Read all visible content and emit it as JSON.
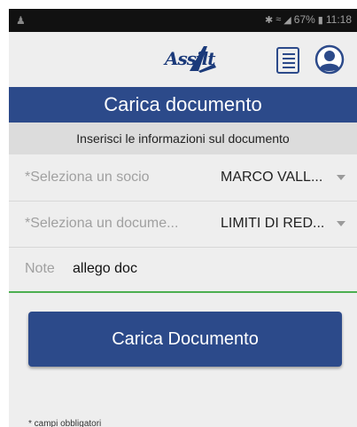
{
  "status_bar": {
    "battery": "67%",
    "time": "11:18",
    "icons": [
      "app-notification-icon",
      "bluetooth-icon",
      "wifi-icon",
      "signal-icon",
      "battery-icon"
    ]
  },
  "app_bar": {
    "logo_text": "Assilt",
    "icons": [
      "document-list-icon",
      "profile-icon"
    ]
  },
  "page": {
    "title": "Carica documento",
    "subtitle": "Inserisci le informazioni sul documento"
  },
  "form": {
    "member": {
      "label": "*Seleziona un socio",
      "value": "MARCO VALL..."
    },
    "document": {
      "label": "*Seleziona un docume...",
      "value": "LIMITI DI RED..."
    },
    "note": {
      "label": "Note",
      "value": "allego doc"
    }
  },
  "actions": {
    "upload_label": "Carica Documento"
  },
  "footer": {
    "required_note": "* campi obbligatori"
  },
  "colors": {
    "primary": "#2c4a8a",
    "focus_underline": "#4caf50",
    "background": "#eeeeee"
  }
}
